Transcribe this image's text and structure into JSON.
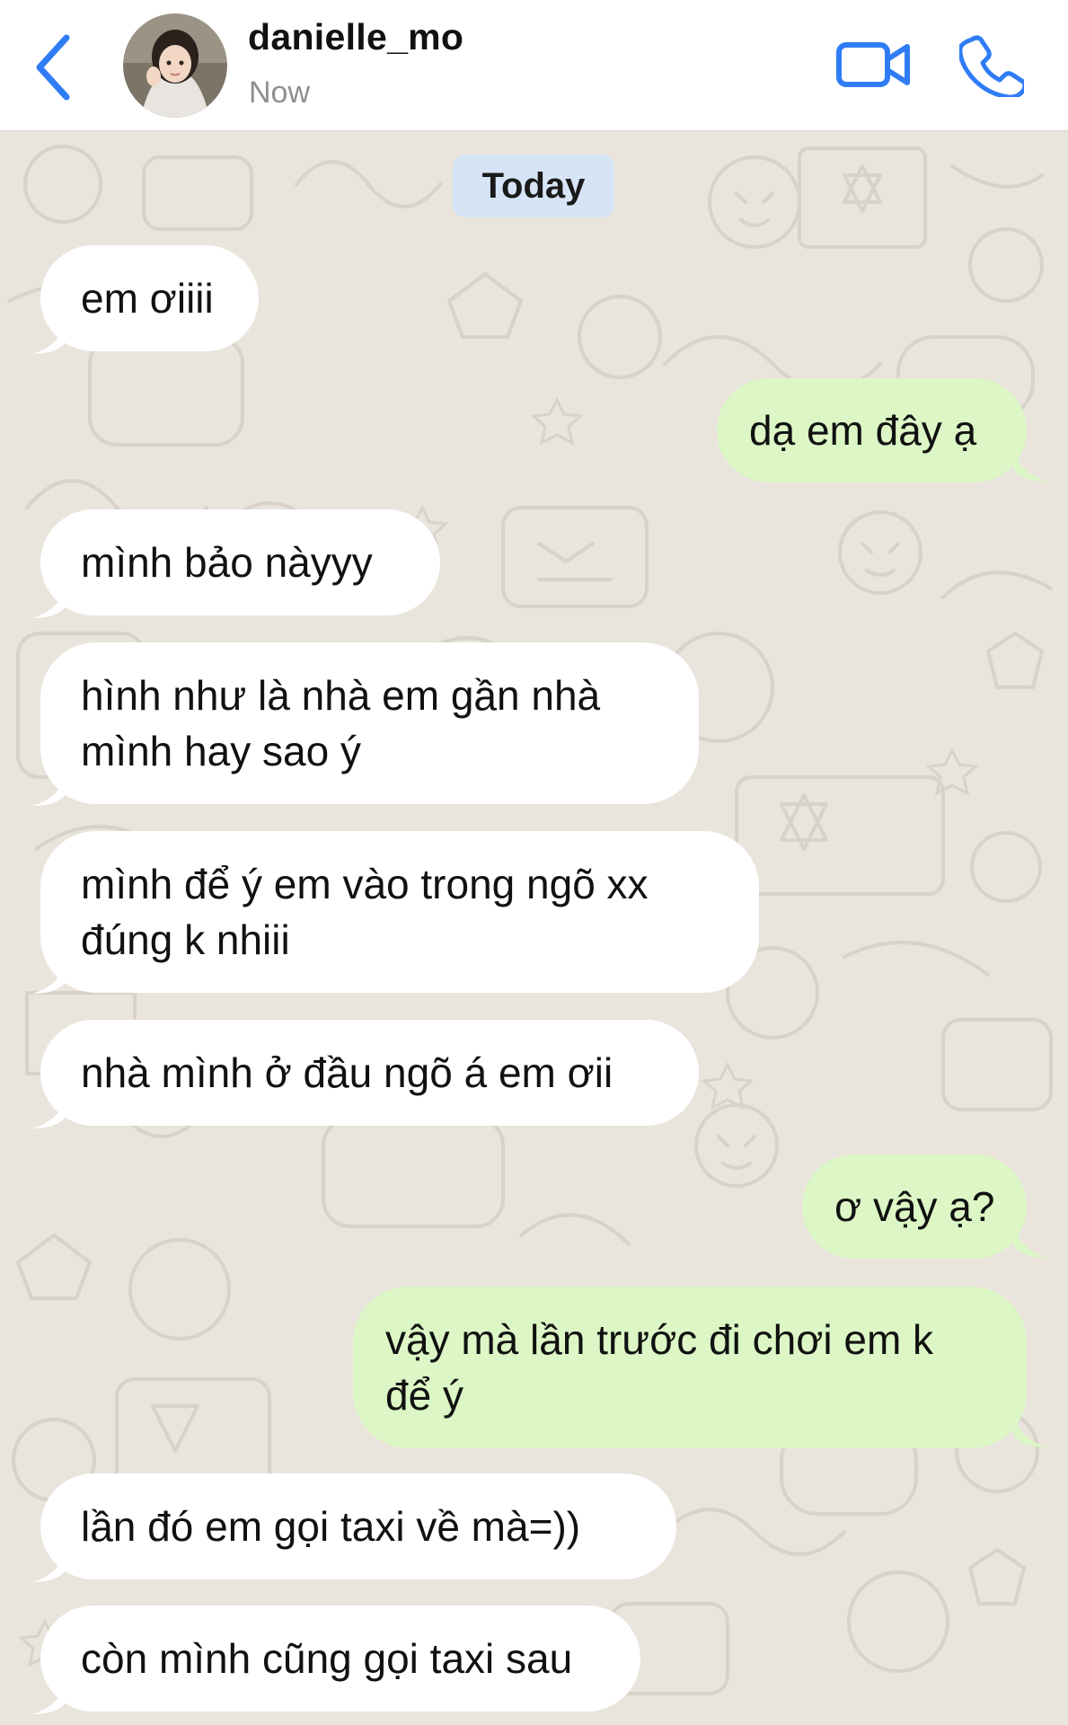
{
  "header": {
    "back_icon": "chevron-left-icon",
    "contact_name": "danielle_mo",
    "status": "Now",
    "video_icon": "video-camera-icon",
    "phone_icon": "phone-icon",
    "accent_color": "#2f7cf6"
  },
  "chat": {
    "date_label": "Today",
    "incoming_color": "#ffffff",
    "outgoing_color": "#dcf7c5",
    "messages": [
      {
        "direction": "incoming",
        "text": "em ơiiii"
      },
      {
        "direction": "outgoing",
        "text": "dạ em đây ạ"
      },
      {
        "direction": "incoming",
        "text": "mình bảo nàyyy"
      },
      {
        "direction": "incoming",
        "text": "hình như là nhà em gần nhà\nmình hay sao ý"
      },
      {
        "direction": "incoming",
        "text": "mình để ý em vào trong ngõ xx\nđúng k nhiii"
      },
      {
        "direction": "incoming",
        "text": "nhà mình ở đầu ngõ á em ơii"
      },
      {
        "direction": "outgoing",
        "text": "ơ vậy ạ?"
      },
      {
        "direction": "outgoing",
        "text": "vậy mà lần trước đi chơi em k\nđể ý"
      },
      {
        "direction": "incoming",
        "text": "lần đó em gọi taxi về mà=))"
      },
      {
        "direction": "incoming",
        "text": "còn mình cũng gọi taxi sau"
      }
    ]
  }
}
